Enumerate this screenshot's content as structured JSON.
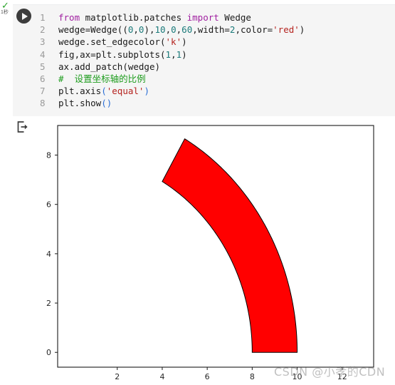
{
  "notebook": {
    "status": {
      "check_icon": "check-icon",
      "elapsed": "1秒"
    },
    "run_button_icon": "play-icon",
    "output_icon": "output-arrow-icon"
  },
  "code_cell": {
    "language": "python",
    "lines": [
      {
        "number": "1",
        "tokens": [
          {
            "t": "from",
            "c": "kw"
          },
          {
            "t": " matplotlib.patches ",
            "c": "plain"
          },
          {
            "t": "import",
            "c": "kw"
          },
          {
            "t": " Wedge",
            "c": "plain"
          }
        ]
      },
      {
        "number": "2",
        "tokens": [
          {
            "t": "wedge=Wedge",
            "c": "plain"
          },
          {
            "t": "((",
            "c": "paren"
          },
          {
            "t": "0",
            "c": "num"
          },
          {
            "t": ",",
            "c": "plain"
          },
          {
            "t": "0",
            "c": "num"
          },
          {
            "t": "),",
            "c": "paren"
          },
          {
            "t": "10",
            "c": "num"
          },
          {
            "t": ",",
            "c": "plain"
          },
          {
            "t": "0",
            "c": "num"
          },
          {
            "t": ",",
            "c": "plain"
          },
          {
            "t": "60",
            "c": "num"
          },
          {
            "t": ",width=",
            "c": "plain"
          },
          {
            "t": "2",
            "c": "num"
          },
          {
            "t": ",color=",
            "c": "plain"
          },
          {
            "t": "'red'",
            "c": "str"
          },
          {
            "t": ")",
            "c": "paren"
          }
        ]
      },
      {
        "number": "3",
        "tokens": [
          {
            "t": "wedge.set_edgecolor",
            "c": "plain"
          },
          {
            "t": "(",
            "c": "paren"
          },
          {
            "t": "'k'",
            "c": "str"
          },
          {
            "t": ")",
            "c": "paren"
          }
        ]
      },
      {
        "number": "4",
        "tokens": [
          {
            "t": "fig,ax=plt.subplots",
            "c": "plain"
          },
          {
            "t": "(",
            "c": "paren"
          },
          {
            "t": "1",
            "c": "num"
          },
          {
            "t": ",",
            "c": "plain"
          },
          {
            "t": "1",
            "c": "num"
          },
          {
            "t": ")",
            "c": "paren"
          }
        ]
      },
      {
        "number": "5",
        "tokens": [
          {
            "t": "ax.add_patch",
            "c": "plain"
          },
          {
            "t": "(",
            "c": "paren"
          },
          {
            "t": "wedge",
            "c": "plain"
          },
          {
            "t": ")",
            "c": "paren"
          }
        ]
      },
      {
        "number": "6",
        "tokens": [
          {
            "t": "#  设置坐标轴的比例",
            "c": "comment"
          }
        ]
      },
      {
        "number": "7",
        "tokens": [
          {
            "t": "plt.axis",
            "c": "plain"
          },
          {
            "t": "(",
            "c": "paren-b"
          },
          {
            "t": "'equal'",
            "c": "str"
          },
          {
            "t": ")",
            "c": "paren-b"
          }
        ]
      },
      {
        "number": "8",
        "tokens": [
          {
            "t": "plt.show",
            "c": "plain"
          },
          {
            "t": "()",
            "c": "paren-b"
          }
        ]
      }
    ]
  },
  "chart_data": {
    "type": "patch",
    "title": "",
    "xlabel": "",
    "ylabel": "",
    "grid": false,
    "legend": null,
    "xlim": [
      -0.65,
      13.4
    ],
    "ylim": [
      -0.6,
      9.2
    ],
    "xticks": [
      2,
      4,
      6,
      8,
      10,
      12
    ],
    "xtick_labels": [
      "2",
      "4",
      "6",
      "8",
      "10",
      "12"
    ],
    "yticks": [
      0,
      2,
      4,
      6,
      8
    ],
    "ytick_labels": [
      "0",
      "2",
      "4",
      "6",
      "8"
    ],
    "aspect": "equal",
    "patches": [
      {
        "kind": "wedge",
        "center": [
          0,
          0
        ],
        "radius": 10,
        "inner_radius": 8,
        "theta1": 0,
        "theta2": 60,
        "width": 2,
        "facecolor": "#ff0000",
        "edgecolor": "#000000",
        "linewidth": 1
      }
    ]
  },
  "watermark": {
    "text": "CSDN @小孝的CDN"
  }
}
